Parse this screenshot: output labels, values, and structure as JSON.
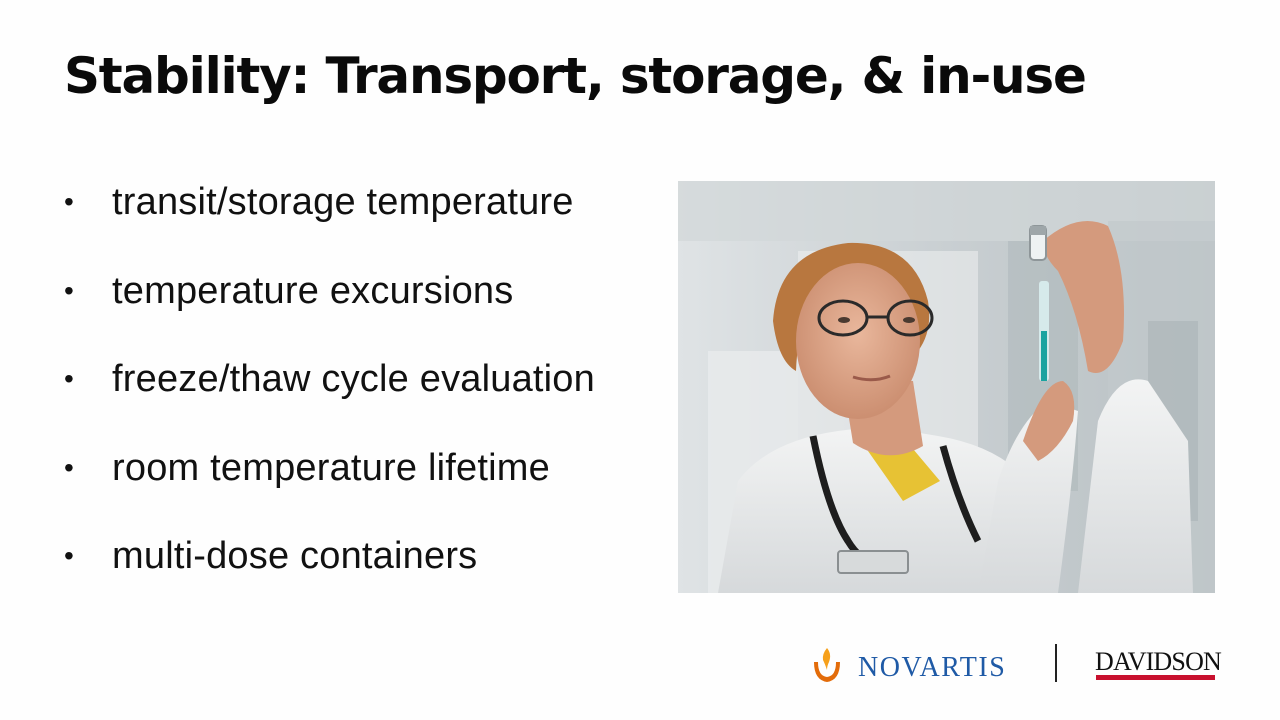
{
  "slide": {
    "title": "Stability: Transport, storage, & in-use",
    "bullet_symbol": "•",
    "bullets": [
      "transit/storage temperature",
      "temperature excursions",
      "freeze/thaw cycle evaluation",
      "room temperature lifetime",
      "multi-dose containers"
    ]
  },
  "photo": {
    "icon": "photo-clinician-with-vial-and-syringe"
  },
  "logos": {
    "novartis": "NOVARTIS",
    "divider": "|",
    "davidson": "DAVIDSON",
    "novartis_color": "#1f5aa6",
    "novartis_flame_colors": [
      "#e36c0a",
      "#f6a01a"
    ],
    "davidson_bar_color": "#c8102e"
  }
}
